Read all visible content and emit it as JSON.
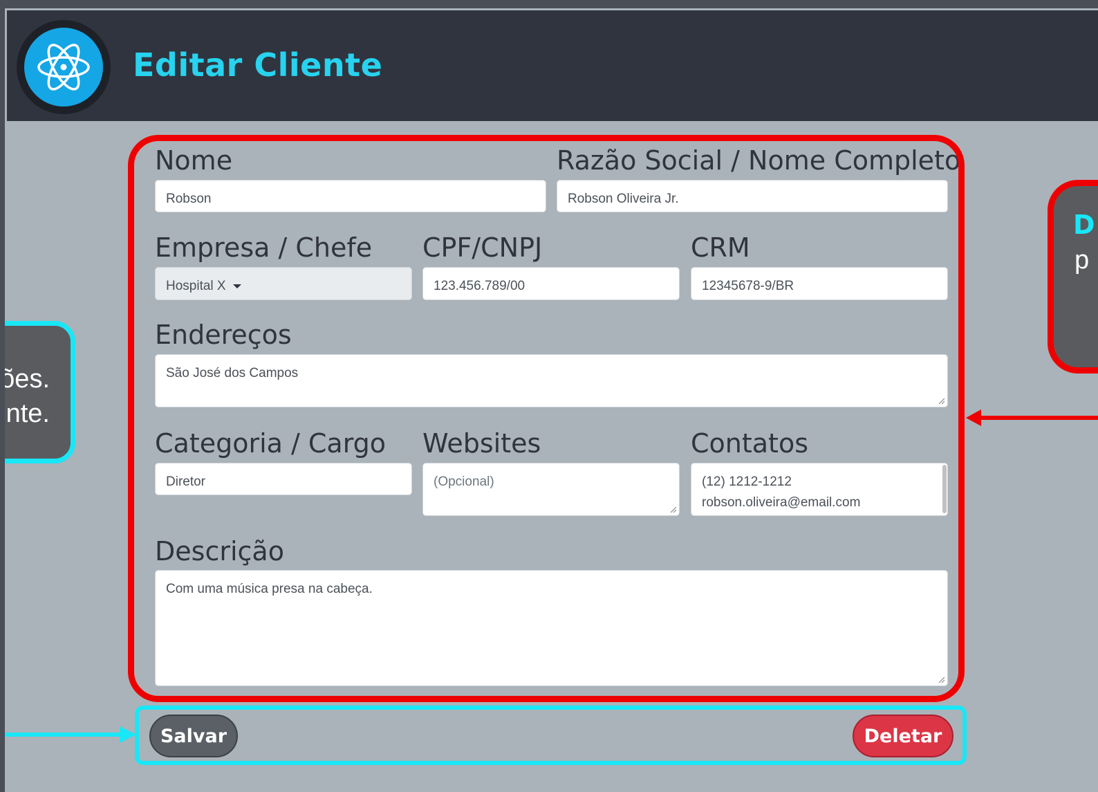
{
  "header": {
    "title": "Editar Cliente"
  },
  "form": {
    "nome": {
      "label": "Nome",
      "value": "Robson"
    },
    "razao": {
      "label": "Razão Social / Nome Completo",
      "value": "Robson Oliveira Jr."
    },
    "empresa": {
      "label": "Empresa / Chefe",
      "value": "Hospital X"
    },
    "cpf": {
      "label": "CPF/CNPJ",
      "value": "123.456.789/00"
    },
    "crm": {
      "label": "CRM",
      "value": "12345678-9/BR"
    },
    "enderecos": {
      "label": "Endereços",
      "value": "São José dos Campos"
    },
    "categoria": {
      "label": "Categoria / Cargo",
      "value": "Diretor"
    },
    "websites": {
      "label": "Websites",
      "placeholder": "(Opcional)"
    },
    "contatos": {
      "label": "Contatos",
      "line1": "(12) 1212-1212",
      "line2": "robson.oliveira@email.com"
    },
    "descricao": {
      "label": "Descrição",
      "value": "Com uma música presa na cabeça."
    }
  },
  "buttons": {
    "save": "Salvar",
    "delete": "Deletar"
  },
  "callouts": {
    "left_line1": "ões.",
    "left_line2": "nte.",
    "right_initial": "D",
    "right_line1": "p"
  },
  "colors": {
    "header_bg": "#30343f",
    "title": "#27d3ee",
    "annotation_red": "#ee0000",
    "annotation_cyan": "#18e7f7",
    "delete_button": "#dc3545",
    "save_button": "#5a6066"
  }
}
